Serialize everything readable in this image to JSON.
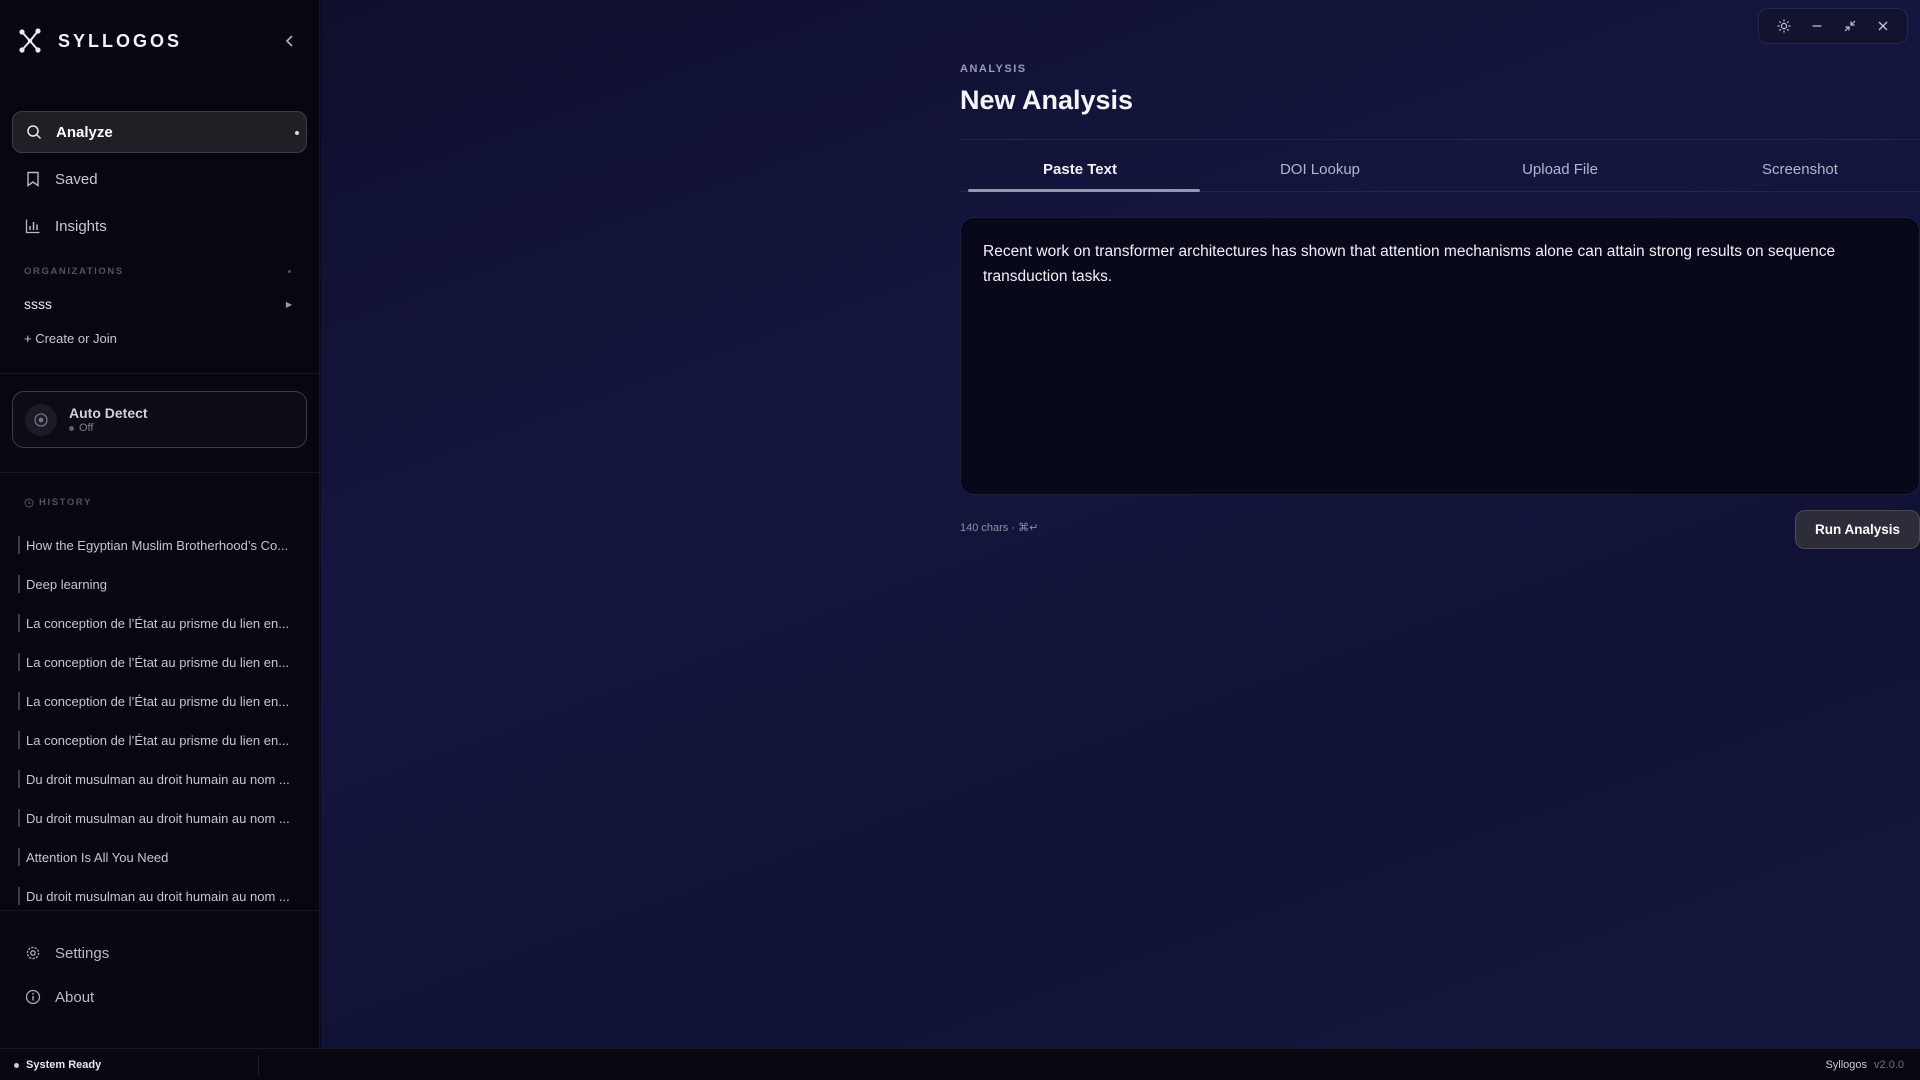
{
  "app": {
    "name": "SYLLOGOS"
  },
  "sidebar": {
    "nav": [
      {
        "label": "Analyze",
        "icon": "search-icon",
        "active": true
      },
      {
        "label": "Saved",
        "icon": "bookmark-icon",
        "active": false
      },
      {
        "label": "Insights",
        "icon": "bar-chart-icon",
        "active": false
      }
    ],
    "organizations_label": "ORGANIZATIONS",
    "organizations": [
      {
        "name": "ssss"
      }
    ],
    "create_join": "+ Create or Join",
    "auto_detect": {
      "title": "Auto Detect",
      "status": "Off"
    },
    "history_label": "HISTORY",
    "history": [
      "How the Egyptian Muslim Brotherhood’s Co...",
      "Deep learning",
      "La conception de l’État au prisme du lien en...",
      "La conception de l’État au prisme du lien en...",
      "La conception de l’État au prisme du lien en...",
      "La conception de l’État au prisme du lien en...",
      "Du droit musulman au droit humain au nom ...",
      "Du droit musulman au droit humain au nom ...",
      "Attention Is All You Need",
      "Du droit musulman au droit humain au nom ..."
    ],
    "footer": [
      {
        "label": "Settings",
        "icon": "gear-icon"
      },
      {
        "label": "About",
        "icon": "info-icon"
      }
    ]
  },
  "main": {
    "eyebrow": "ANALYSIS",
    "title": "New Analysis",
    "tabs": [
      {
        "label": "Paste Text",
        "active": true
      },
      {
        "label": "DOI Lookup",
        "active": false
      },
      {
        "label": "Upload File",
        "active": false
      },
      {
        "label": "Screenshot",
        "active": false
      }
    ],
    "editor_text": "Recent work on transformer architectures has shown that attention mechanisms alone can attain strong results on sequence transduction tasks.",
    "char_count": "140 chars",
    "shortcut": "⌘↵",
    "run_button": "Run Analysis"
  },
  "status": {
    "left": "System Ready",
    "app": "Syllogos",
    "version": "v2.0.0"
  },
  "colors": {
    "sidebar": "#07080f",
    "main_bg": "#12143a",
    "accent": "#9598ac"
  }
}
